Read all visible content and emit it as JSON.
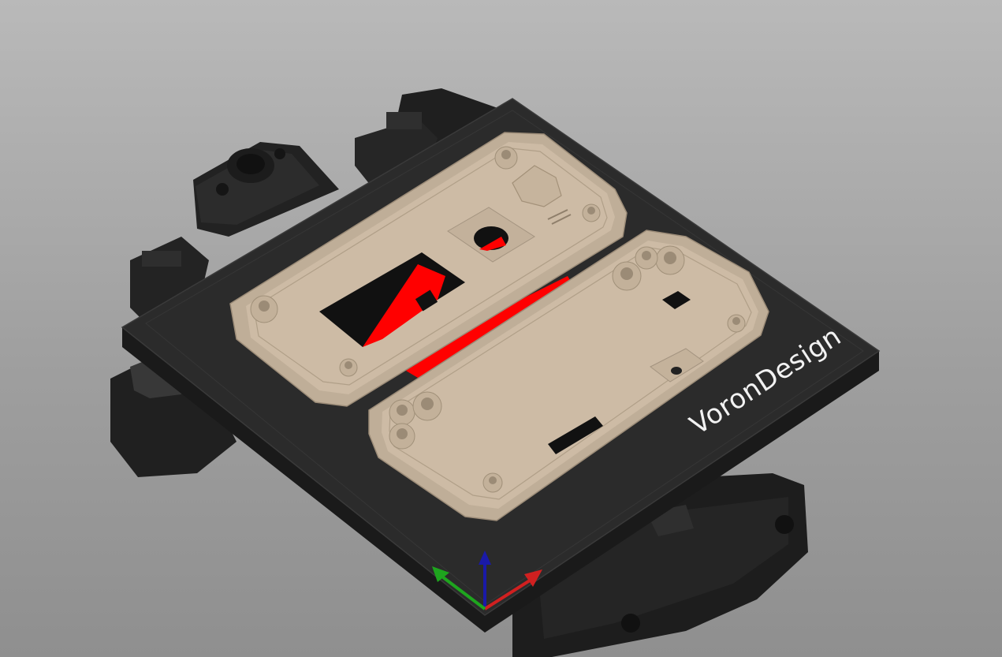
{
  "window": {
    "kind": "slicer-3d-viewport"
  },
  "plate": {
    "label": "VoronDesign",
    "label_color": "#f2f2f2",
    "surface_color": "#2b2b2b",
    "edge_color": "#1a1a1a"
  },
  "parts": {
    "material_color": "#cdbba5",
    "overhang_color": "#ff0000",
    "printer_parts_color": "#1f1f1f"
  },
  "axes": {
    "x_color": "#d02020",
    "y_color": "#1ea51e",
    "z_color": "#1a1aa8"
  },
  "icons": [
    "voron-logo-icon",
    "axes-gizmo-icon"
  ]
}
